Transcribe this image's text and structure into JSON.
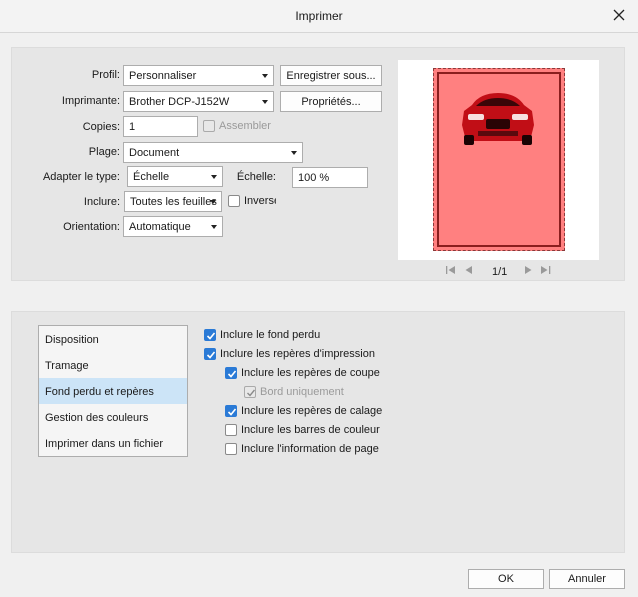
{
  "window": {
    "title": "Imprimer"
  },
  "form": {
    "profile_label": "Profil:",
    "profile_value": "Personnaliser",
    "save_button": "Enregistrer sous...",
    "printer_label": "Imprimante:",
    "printer_value": "Brother DCP-J152W",
    "properties_button": "Propriétés...",
    "copies_label": "Copies:",
    "copies_value": "1",
    "collate_label": "Assembler",
    "range_label": "Plage:",
    "range_value": "Document",
    "fit_label": "Adapter le type:",
    "fit_value": "Échelle",
    "scale_label": "Échelle:",
    "scale_value": "100 %",
    "include_label": "Inclure:",
    "include_value": "Toutes les feuilles",
    "reverse_label": "Inverse",
    "orientation_label": "Orientation:",
    "orientation_value": "Automatique"
  },
  "preview": {
    "page_indicator": "1/1"
  },
  "categories": [
    {
      "label": "Disposition",
      "selected": false
    },
    {
      "label": "Tramage",
      "selected": false
    },
    {
      "label": "Fond perdu et repères",
      "selected": true
    },
    {
      "label": "Gestion des couleurs",
      "selected": false
    },
    {
      "label": "Imprimer dans un fichier",
      "selected": false
    }
  ],
  "options": {
    "bleed": "Inclure le fond perdu",
    "print_marks": "Inclure les repères d'impression",
    "crop_marks": "Inclure les repères de coupe",
    "edge_only": "Bord uniquement",
    "registration_marks": "Inclure les repères de calage",
    "color_bars": "Inclure les barres de couleur",
    "page_info": "Inclure l'information de page"
  },
  "footer": {
    "ok": "OK",
    "cancel": "Annuler"
  },
  "colors": {
    "accent": "#2a7ad6",
    "selection": "#cce4f7",
    "bleed": "#ff8080"
  }
}
